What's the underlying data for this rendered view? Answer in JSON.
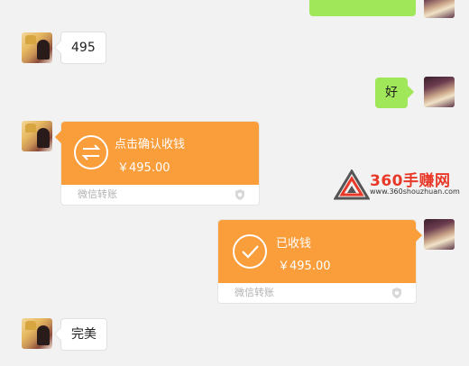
{
  "messages": {
    "top_right_bubble_partial": "",
    "msg1": "495",
    "msg2": "好",
    "transfer_pending": {
      "title": "点击确认收钱",
      "amount": "￥495.00",
      "footer": "微信转账"
    },
    "transfer_received": {
      "title": "已收钱",
      "amount": "￥495.00",
      "footer": "微信转账"
    },
    "msg3": "完美"
  },
  "watermark": {
    "brand": "360手赚网",
    "url": "www.360shouzhuan.com"
  },
  "colors": {
    "background": "#f2f2f2",
    "transfer_orange": "#fa9d3b",
    "self_bubble_green": "#a0e75a",
    "watermark_red": "#e83828"
  },
  "icons": {
    "pending": "exchange-arrows-icon",
    "received": "checkmark-icon",
    "shield": "shield-icon"
  }
}
